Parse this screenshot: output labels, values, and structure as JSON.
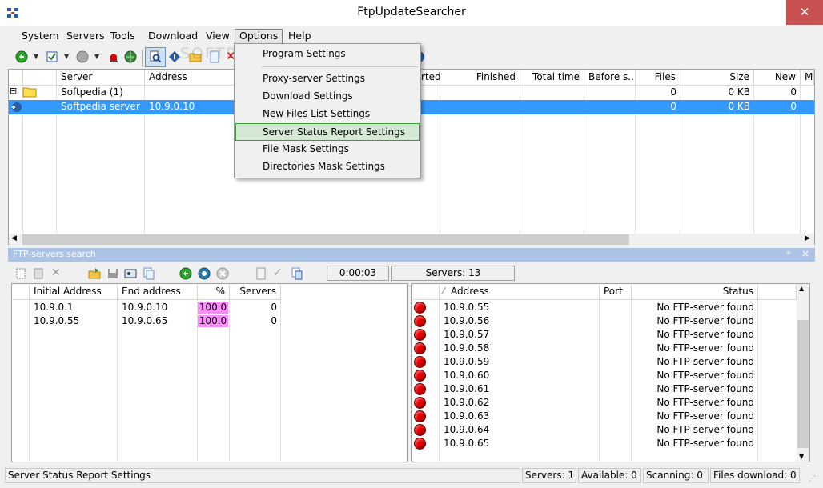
{
  "window": {
    "title": "FtpUpdateSearcher",
    "close_glyph": "✕"
  },
  "menu": [
    "System",
    "Servers",
    "Tools",
    "Download",
    "View",
    "Options",
    "Help"
  ],
  "options_menu": {
    "items": [
      "Program Settings",
      "Proxy-server Settings",
      "Download Settings",
      "New Files List Settings",
      "Server Status Report Settings",
      "File Mask Settings",
      "Directories Mask Settings"
    ],
    "highlighted": "Server Status Report Settings"
  },
  "upper_table": {
    "columns": [
      "Server",
      "Address",
      "rted",
      "Finished",
      "Total time",
      "Before s...",
      "Files",
      "Size",
      "New",
      "M"
    ],
    "rows": [
      {
        "server": "Softpedia (1)",
        "address": "",
        "files": "0",
        "size": "0 KB",
        "new": "0"
      },
      {
        "server": "Softpedia server",
        "address": "10.9.0.10",
        "files": "0",
        "size": "0 KB",
        "new": "0"
      }
    ]
  },
  "search_pane": {
    "title": "FTP-servers search",
    "timer": "0:00:03",
    "servers_count": "Servers: 13",
    "pin_glyph": "ᵖ",
    "close_glyph": "×",
    "ranges": {
      "columns": [
        "Initial Address",
        "End address",
        "%",
        "Servers"
      ],
      "rows": [
        {
          "start": "10.9.0.1",
          "end": "10.9.0.10",
          "pct": "100.0",
          "servers": "0"
        },
        {
          "start": "10.9.0.55",
          "end": "10.9.0.65",
          "pct": "100.0",
          "servers": "0"
        }
      ]
    },
    "results": {
      "columns": [
        "Address",
        "Port",
        "Status"
      ],
      "sort_glyph": "⁄",
      "rows": [
        {
          "address": "10.9.0.55",
          "status": "No FTP-server found"
        },
        {
          "address": "10.9.0.56",
          "status": "No FTP-server found"
        },
        {
          "address": "10.9.0.57",
          "status": "No FTP-server found"
        },
        {
          "address": "10.9.0.58",
          "status": "No FTP-server found"
        },
        {
          "address": "10.9.0.59",
          "status": "No FTP-server found"
        },
        {
          "address": "10.9.0.60",
          "status": "No FTP-server found"
        },
        {
          "address": "10.9.0.61",
          "status": "No FTP-server found"
        },
        {
          "address": "10.9.0.62",
          "status": "No FTP-server found"
        },
        {
          "address": "10.9.0.63",
          "status": "No FTP-server found"
        },
        {
          "address": "10.9.0.64",
          "status": "No FTP-server found"
        },
        {
          "address": "10.9.0.65",
          "status": "No FTP-server found"
        }
      ]
    }
  },
  "statusbar": {
    "message": "Server Status Report Settings",
    "servers": "Servers: 1",
    "available": "Available: 0",
    "scanning": "Scanning: 0",
    "downloads": "Files download: 0"
  },
  "watermark": "SOFTPEDIA",
  "colors": {
    "selection": "#3399ff",
    "percent_fill": "#ff8cff",
    "status_dot": "#e80000",
    "pane_header": "#adc3e6",
    "menu_highlight": "#d3e9d3"
  }
}
